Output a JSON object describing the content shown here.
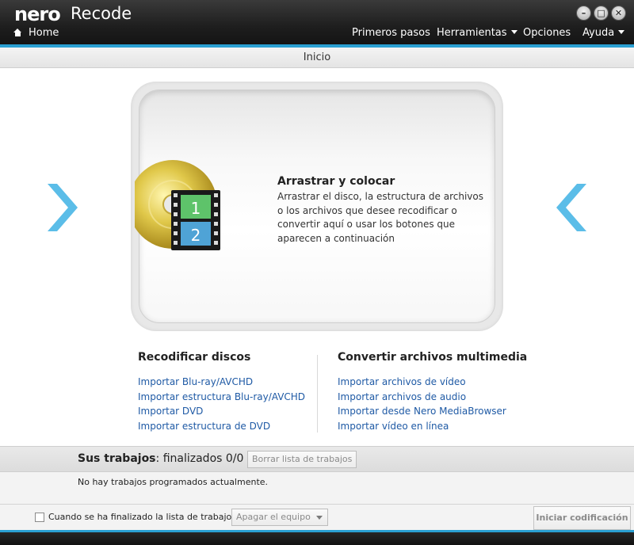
{
  "app": {
    "logo": "nero",
    "name": "Recode"
  },
  "window_buttons": [
    "minimize",
    "maximize",
    "close"
  ],
  "nav": {
    "home": "Home",
    "items": [
      {
        "label": "Primeros pasos"
      },
      {
        "label": "Herramientas"
      },
      {
        "label": "Opciones"
      },
      {
        "label": "Ayuda"
      }
    ]
  },
  "breadcrumb": "Inicio",
  "dropzone": {
    "title": "Arrastrar y colocar",
    "text": "Arrastrar el disco, la estructura de archivos o los archivos que desee recodificar o convertir aquí o usar los botones que aparecen a continuación",
    "film_frames": [
      "1",
      "2"
    ]
  },
  "recode_discs": {
    "title": "Recodificar discos",
    "links": [
      "Importar Blu-ray/AVCHD",
      "Importar estructura Blu-ray/AVCHD",
      "Importar DVD",
      "Importar estructura de DVD"
    ]
  },
  "convert_media": {
    "title": "Convertir archivos multimedia",
    "links": [
      "Importar archivos de vídeo",
      "Importar archivos de audio",
      "Importar desde Nero MediaBrowser",
      "Importar vídeo en línea"
    ]
  },
  "jobs": {
    "title": "Sus trabajos",
    "status": ": finalizados 0/0",
    "clear_button": "Borrar lista de trabajos",
    "empty_message": "No hay trabajos programados actualmente."
  },
  "footer": {
    "checkbox_label": "Cuando se ha finalizado la lista de trabajos:",
    "checkbox_checked": false,
    "select_value": "Apagar el equipo",
    "start_button": "Iniciar codificación"
  },
  "colors": {
    "accent": "#2aa0d2",
    "link": "#1f5aa5",
    "arrow": "#5bbde8"
  }
}
